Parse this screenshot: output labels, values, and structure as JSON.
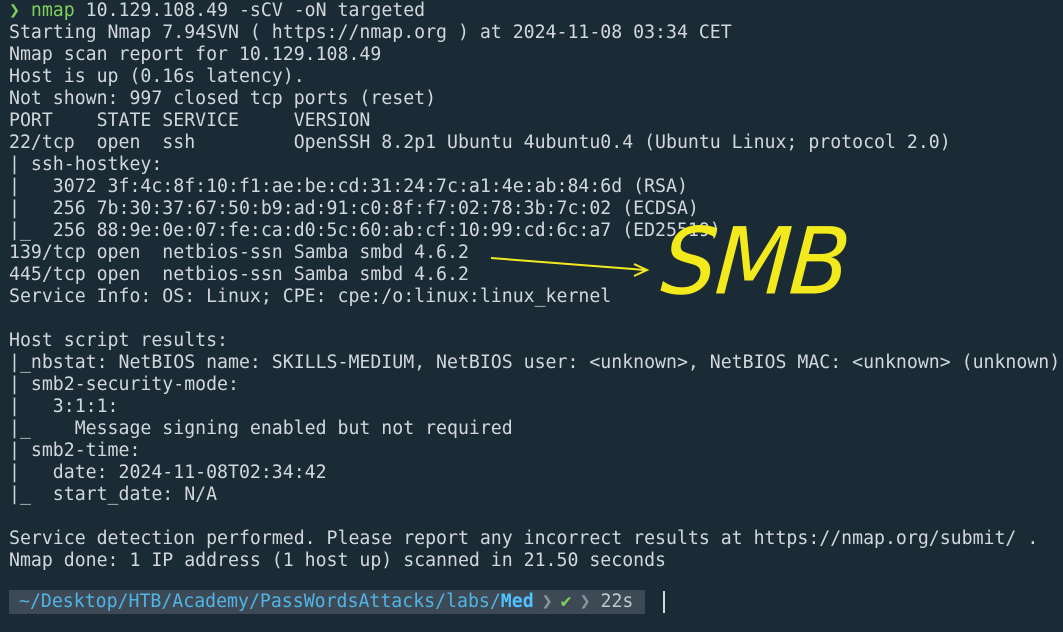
{
  "terminal": {
    "prompt_arrow": "❯",
    "command": "nmap",
    "command_args": " 10.129.108.49 -sCV -oN targeted",
    "lines": [
      "Starting Nmap 7.94SVN ( https://nmap.org ) at 2024-11-08 03:34 CET",
      "Nmap scan report for 10.129.108.49",
      "Host is up (0.16s latency).",
      "Not shown: 997 closed tcp ports (reset)",
      "PORT    STATE SERVICE     VERSION",
      "22/tcp  open  ssh         OpenSSH 8.2p1 Ubuntu 4ubuntu0.4 (Ubuntu Linux; protocol 2.0)",
      "| ssh-hostkey:",
      "|   3072 3f:4c:8f:10:f1:ae:be:cd:31:24:7c:a1:4e:ab:84:6d (RSA)",
      "|   256 7b:30:37:67:50:b9:ad:91:c0:8f:f7:02:78:3b:7c:02 (ECDSA)",
      "|_  256 88:9e:0e:07:fe:ca:d0:5c:60:ab:cf:10:99:cd:6c:a7 (ED25519)",
      "139/tcp open  netbios-ssn Samba smbd 4.6.2",
      "445/tcp open  netbios-ssn Samba smbd 4.6.2",
      "Service Info: OS: Linux; CPE: cpe:/o:linux:linux_kernel",
      "",
      "Host script results:",
      "|_nbstat: NetBIOS name: SKILLS-MEDIUM, NetBIOS user: <unknown>, NetBIOS MAC: <unknown> (unknown)",
      "| smb2-security-mode:",
      "|   3:1:1:",
      "|_    Message signing enabled but not required",
      "| smb2-time:",
      "|   date: 2024-11-08T02:34:42",
      "|_  start_date: N/A",
      "",
      "Service detection performed. Please report any incorrect results at https://nmap.org/submit/ .",
      "Nmap done: 1 IP address (1 host up) scanned in 21.50 seconds"
    ]
  },
  "annotation": {
    "text": "SMB",
    "color": "#f2ea1d"
  },
  "prompt": {
    "path_prefix": "~/Desktop/HTB/Academy/PassWordsAttacks/labs/",
    "path_current": "Med",
    "status_icon": "✔",
    "duration": "22s"
  }
}
